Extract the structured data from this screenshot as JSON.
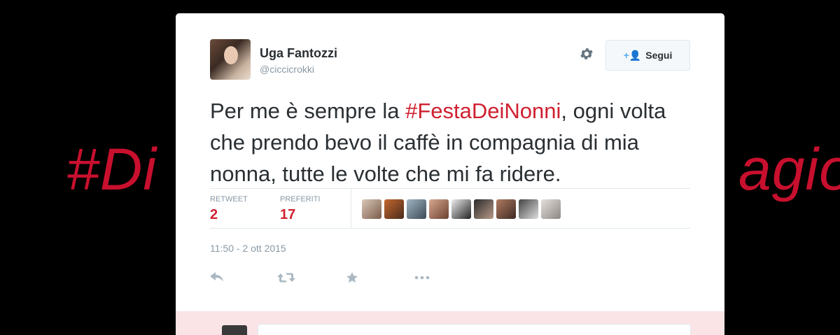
{
  "background": {
    "hashtag_left": "#Di",
    "hashtag_right": "agio",
    "color": "#c8102e"
  },
  "tweet": {
    "user": {
      "name": "Uga Fantozzi",
      "handle": "@ciccicrokki",
      "avatar_icon": "user-avatar"
    },
    "follow_label": "Segui",
    "follow_icon": "add-user-icon",
    "text_before": "Per me è sempre la ",
    "hashtag": "#FestaDeiNonni",
    "text_after": ", ogni volta che prendo bevo il caffè in compagnia di mia nonna, tutte le volte che mi fa ridere.",
    "stats": {
      "retweets_label": "RETWEET",
      "retweets_value": "2",
      "favorites_label": "PREFERITI",
      "favorites_value": "17"
    },
    "favoriters_count_shown": 9,
    "timestamp": "11:50 - 2 ott 2015",
    "actions": [
      "reply-icon",
      "retweet-icon",
      "favorite-icon",
      "more-icon"
    ],
    "colors": {
      "accent": "#55acee",
      "hashtag": "#d02030",
      "muted": "#8899a6",
      "text": "#292f33"
    }
  }
}
